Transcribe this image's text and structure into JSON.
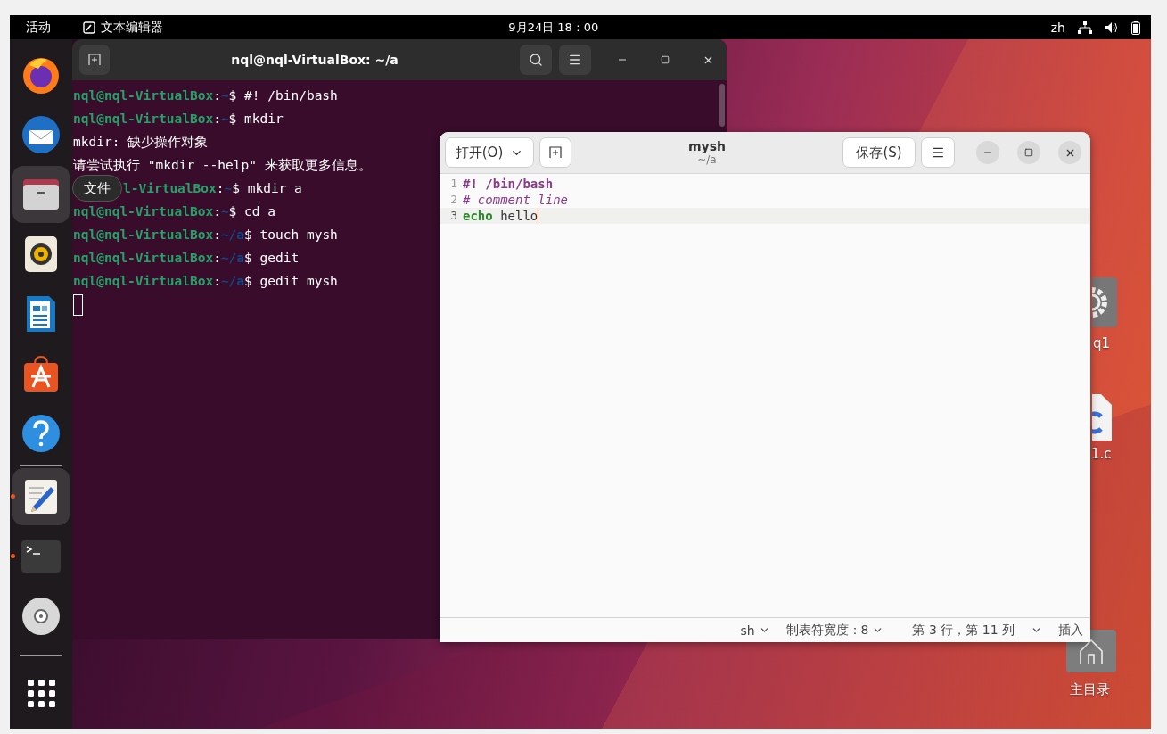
{
  "top_bar": {
    "activities": "活动",
    "app_name": "文本编辑器",
    "clock": "9月24日 18：00",
    "input_method": "zh"
  },
  "dock": {
    "sections": [
      [
        {
          "kind": "firefox",
          "running": false,
          "highlighted": false
        },
        {
          "kind": "thunderbird",
          "running": false,
          "highlighted": false
        },
        {
          "kind": "files",
          "running": false,
          "highlighted": true
        },
        {
          "kind": "rhythmbox",
          "running": false,
          "highlighted": false
        },
        {
          "kind": "writer",
          "running": false,
          "highlighted": false
        },
        {
          "kind": "appstore",
          "running": false,
          "highlighted": false
        },
        {
          "kind": "help",
          "running": false,
          "highlighted": false
        }
      ],
      [
        {
          "kind": "gedit",
          "running": true,
          "highlighted": true
        },
        {
          "kind": "terminal",
          "running": true,
          "highlighted": false
        },
        {
          "kind": "disc",
          "running": false,
          "highlighted": false
        }
      ],
      [
        {
          "kind": "apps",
          "running": false,
          "highlighted": false
        }
      ]
    ],
    "tooltip": "文件"
  },
  "terminal": {
    "title": "nql@nql-VirtualBox: ~/a",
    "lines": [
      {
        "kind": "prompt",
        "host": "nql@nql-VirtualBox",
        "sep": ":",
        "path": "~",
        "sign": "$",
        "command": " #! /bin/bash"
      },
      {
        "kind": "prompt",
        "host": "nql@nql-VirtualBox",
        "sep": ":",
        "path": "~",
        "sign": "$",
        "command": " mkdir"
      },
      {
        "kind": "output",
        "text": "mkdir: 缺少操作对象"
      },
      {
        "kind": "output",
        "text": "请尝试执行 \"mkdir --help\" 来获取更多信息。"
      },
      {
        "kind": "partial_prompt",
        "host": "l-VirtualBox",
        "sep": ":",
        "path": "~",
        "sign": "$",
        "command": " mkdir a"
      },
      {
        "kind": "prompt",
        "host": "nql@nql-VirtualBox",
        "sep": ":",
        "path": "~",
        "sign": "$",
        "command": " cd a"
      },
      {
        "kind": "prompt",
        "host": "nql@nql-VirtualBox",
        "sep": ":",
        "path": "~/a",
        "sign": "$",
        "command": " touch mysh"
      },
      {
        "kind": "prompt",
        "host": "nql@nql-VirtualBox",
        "sep": ":",
        "path": "~/a",
        "sign": "$",
        "command": " gedit"
      },
      {
        "kind": "prompt",
        "host": "nql@nql-VirtualBox",
        "sep": ":",
        "path": "~/a",
        "sign": "$",
        "command": " gedit mysh"
      },
      {
        "kind": "cursor"
      }
    ]
  },
  "editor": {
    "title": "mysh",
    "subtitle": "~/a",
    "open_button": "打开(O)",
    "save_button": "保存(S)",
    "lines": [
      {
        "number": "1",
        "current": false,
        "cursor": false,
        "tokens": [
          {
            "kind": "shebang",
            "text": "#! /bin/bash"
          }
        ]
      },
      {
        "number": "2",
        "current": false,
        "cursor": false,
        "tokens": [
          {
            "kind": "comment",
            "text": "# comment line"
          }
        ]
      },
      {
        "number": "3",
        "current": true,
        "cursor": true,
        "tokens": [
          {
            "kind": "keyword",
            "text": "echo"
          },
          {
            "kind": "plain",
            "text": " hello"
          }
        ]
      }
    ],
    "status": {
      "language": "sh",
      "tab_width": "制表符宽度：8",
      "position": "第 3 行，第 11 列",
      "mode": "插入"
    }
  },
  "desktop_icons": [
    {
      "kind": "settings",
      "label": "q1"
    },
    {
      "kind": "c-file",
      "label": "1.c"
    },
    {
      "kind": "home",
      "label": "主目录"
    }
  ]
}
